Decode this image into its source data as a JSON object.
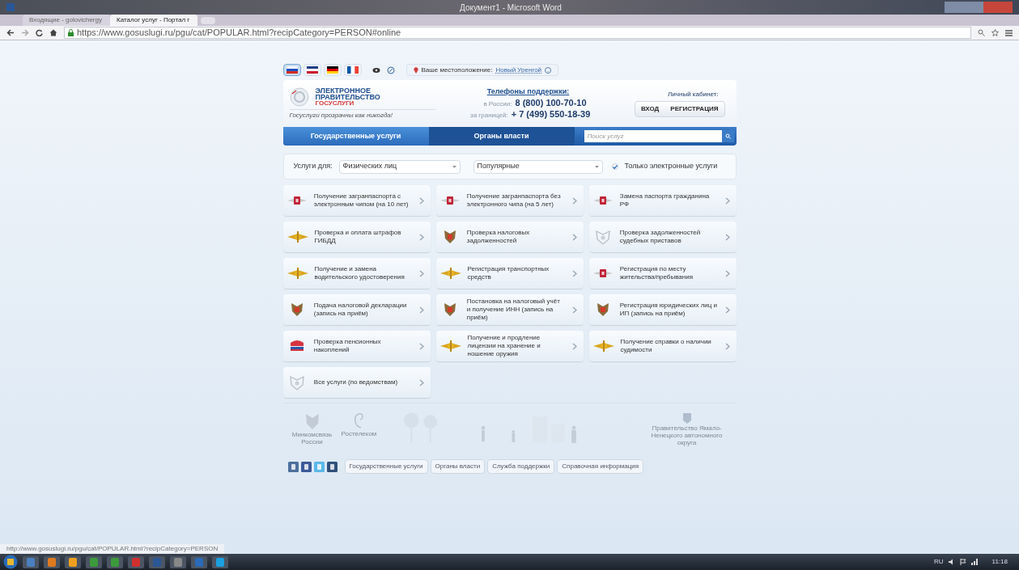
{
  "window": {
    "title": "Документ1 - Microsoft Word"
  },
  "browser": {
    "tabs": [
      {
        "label": "Входящие - golovichergy",
        "selected": false
      },
      {
        "label": "Каталог услуг - Портал г",
        "selected": true
      }
    ],
    "address": "https://www.gosuslugi.ru/pgu/cat/POPULAR.html?recipCategory=PERSON#online"
  },
  "site": {
    "languages": [
      {
        "kind": "ru",
        "selected": true
      },
      {
        "kind": "en",
        "selected": false
      },
      {
        "kind": "de",
        "selected": false
      },
      {
        "kind": "fr",
        "selected": false
      }
    ],
    "location": {
      "label": "Ваше местоположение:",
      "value": "Новый Уренгой"
    },
    "logo": {
      "line_1": "ЭЛЕКТРОННОЕ",
      "line_2": "ПРАВИТЕЛЬСТВО",
      "line_3": "ГОСУСЛУГИ",
      "tagline": "Госуслуги прозрачны как никогда!"
    },
    "support": {
      "title": "Телефоны поддержки:",
      "phones": [
        {
          "label": "в России:",
          "number": "8 (800) 100-70-10"
        },
        {
          "label": "за границей:",
          "number": "+ 7 (499) 550-18-39"
        }
      ]
    },
    "cabinet": {
      "title": "Личный кабинет:",
      "buttons": [
        "ВХОД",
        "РЕГИСТРАЦИЯ"
      ]
    },
    "nav": [
      {
        "label": "Государственные услуги",
        "selected": true
      },
      {
        "label": "Органы власти",
        "selected": false
      }
    ],
    "search": {
      "placeholder": "Поиск услуг"
    },
    "filter": {
      "label": "Услуги для:",
      "recipient": "Физических лиц",
      "category": "Популярные",
      "electronic_only": {
        "label": "Только электронные услуги",
        "checked": true
      }
    },
    "services": [
      {
        "kind": "passport",
        "label": "Получение загранпаспорта с электронным чипом (на 10 лет)"
      },
      {
        "kind": "passport",
        "label": "Получение загранпаспорта без электронного чипа (на 5 лет)"
      },
      {
        "kind": "passport",
        "label": "Замена паспорта гражданина РФ"
      },
      {
        "kind": "police",
        "label": "Проверка и оплата штрафов ГИБДД"
      },
      {
        "kind": "tax",
        "label": "Проверка налоговых задолженностей"
      },
      {
        "kind": "emblem",
        "label": "Проверка задолженностей судебных приставов"
      },
      {
        "kind": "police",
        "label": "Получение и замена водительского удостоверения"
      },
      {
        "kind": "police",
        "label": "Регистрация транспортных средств"
      },
      {
        "kind": "passport",
        "label": "Регистрация по месту жительства/пребывания"
      },
      {
        "kind": "tax",
        "label": "Подача налоговой декларации (запись на приём)"
      },
      {
        "kind": "tax",
        "label": "Постановка на налоговый учёт и получение ИНН (запись на приём)"
      },
      {
        "kind": "tax",
        "label": "Регистрация юридических лиц и ИП (запись на приём)"
      },
      {
        "kind": "pension",
        "label": "Проверка пенсионных накоплений"
      },
      {
        "kind": "police",
        "label": "Получение и продление лицензии на хранение и ношение оружия"
      },
      {
        "kind": "police",
        "label": "Получение справки о наличии судимости"
      },
      {
        "kind": "emblem",
        "label": "Все услуги (по ведомствам)"
      }
    ],
    "footer": {
      "partners": [
        "Минкомсвязь России",
        "Ростелеком"
      ],
      "region": "Правительство Ямало-Ненецкого автономного округа",
      "links": [
        "Государственные услуги",
        "Органы власти",
        "Служба поддержки",
        "Справочная информация"
      ]
    }
  },
  "status_url": "http://www.gosuslugi.ru/pgu/cat/POPULAR.html?recipCategory=PERSON",
  "taskbar": {
    "language": "RU",
    "time": "11:18"
  }
}
